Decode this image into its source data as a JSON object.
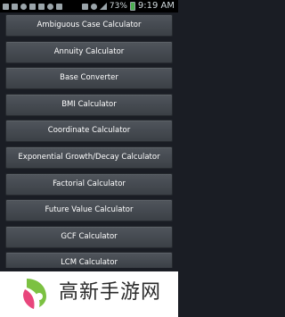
{
  "status_bar": {
    "battery_text": "73%",
    "time": "9:19 AM"
  },
  "calculators": [
    "Ambiguous Case Calculator",
    "Annuity Calculator",
    "Base Converter",
    "BMI Calculator",
    "Coordinate Calculator",
    "Exponential Growth/Decay Calculator",
    "Factorial Calculator",
    "Future Value Calculator",
    "GCF Calculator",
    "LCM Calculator"
  ],
  "watermark": {
    "text": "高新手游网",
    "logo_colors": {
      "green": "#7cc142",
      "pink": "#e8467c"
    }
  },
  "colors": {
    "background": "#1a1d24",
    "button": "#454a50",
    "button_text": "#ffffff"
  }
}
